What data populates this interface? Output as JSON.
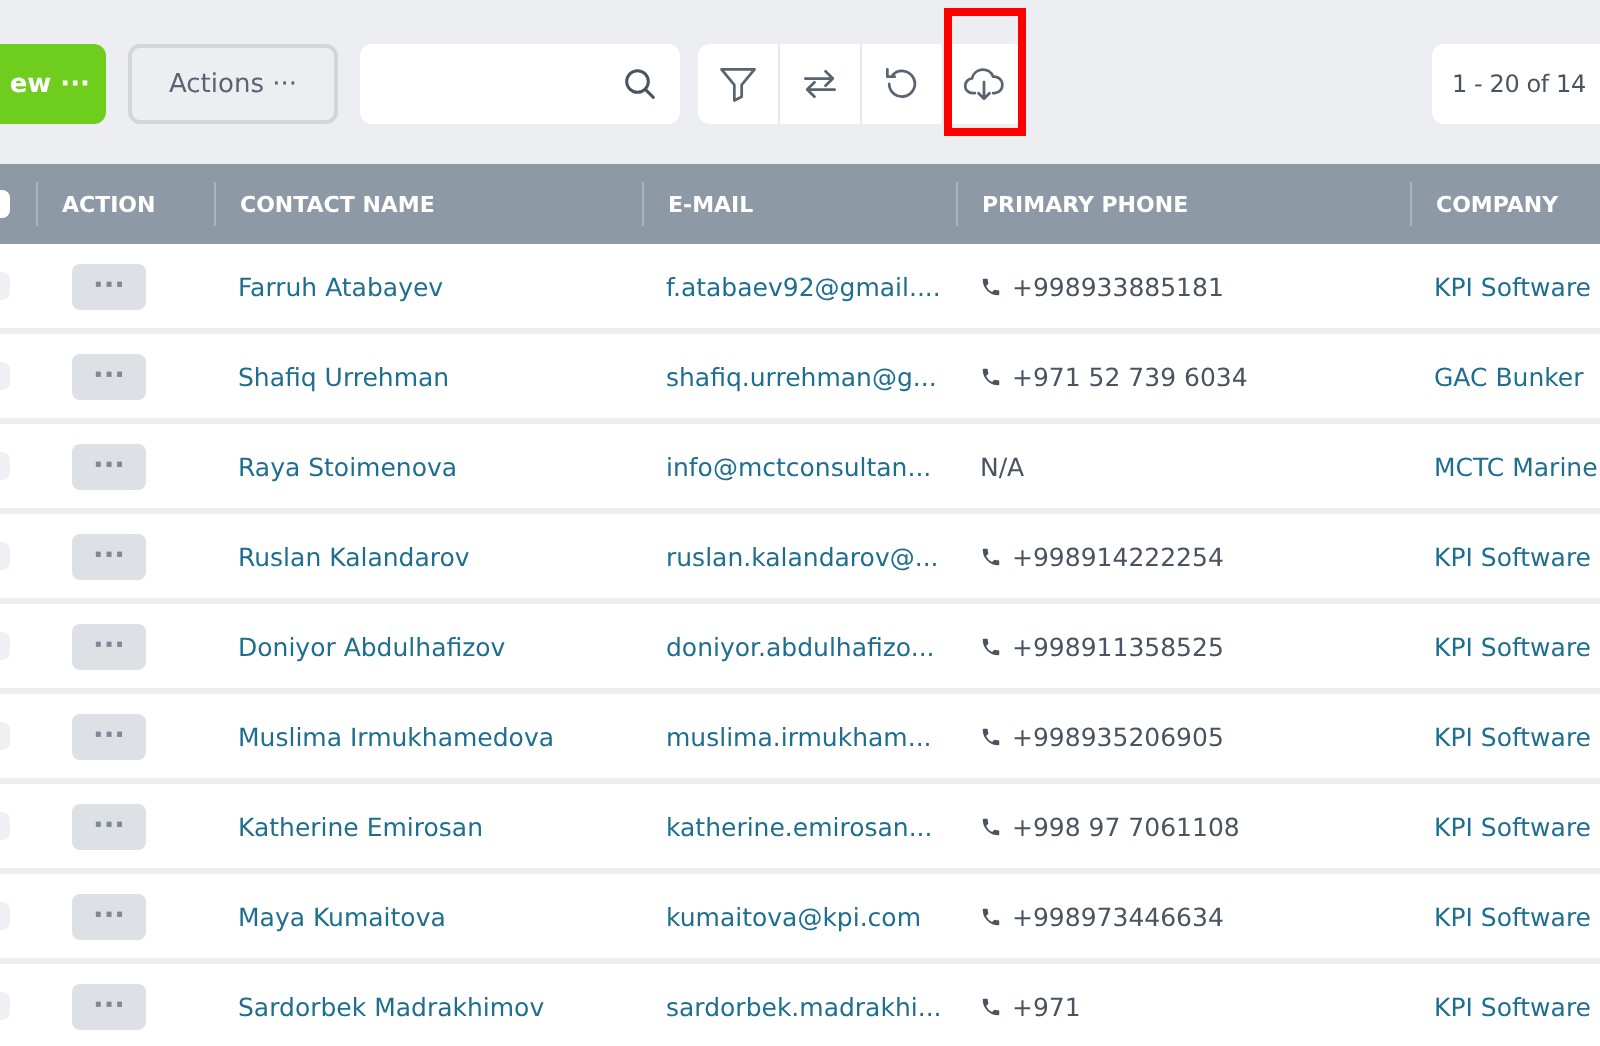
{
  "toolbar": {
    "new_button": "ew ···",
    "actions_button": "Actions ···",
    "tools": [
      {
        "kind": "filter"
      },
      {
        "kind": "swap"
      },
      {
        "kind": "reset"
      },
      {
        "kind": "download",
        "highlighted": true
      }
    ],
    "pagination": "1 - 20 of 14"
  },
  "table": {
    "select_all_checked": false,
    "columns": [
      "ACTION",
      "CONTACT NAME",
      "E-MAIL",
      "PRIMARY PHONE",
      "COMPANY"
    ],
    "rows": [
      {
        "checked": false,
        "action": "···",
        "name": "Farruh Atabayev",
        "email": "f.atabaev92@gmail....",
        "phone": "+998933885181",
        "company": "KPI Software"
      },
      {
        "checked": false,
        "action": "···",
        "name": "Shafiq Urrehman",
        "email": "shafiq.urrehman@g...",
        "phone": "+971 52 739 6034",
        "company": "GAC Bunker"
      },
      {
        "checked": false,
        "action": "···",
        "name": "Raya Stoimenova",
        "email": "info@mctconsultan...",
        "phone": "N/A",
        "company": "MCTC Marine"
      },
      {
        "checked": false,
        "action": "···",
        "name": "Ruslan Kalandarov",
        "email": "ruslan.kalandarov@...",
        "phone": "+998914222254",
        "company": "KPI Software"
      },
      {
        "checked": false,
        "action": "···",
        "name": "Doniyor Abdulhafizov",
        "email": "doniyor.abdulhafizo...",
        "phone": "+998911358525",
        "company": "KPI Software"
      },
      {
        "checked": false,
        "action": "···",
        "name": "Muslima Irmukhamedova",
        "email": "muslima.irmukham...",
        "phone": "+998935206905",
        "company": "KPI Software"
      },
      {
        "checked": false,
        "action": "···",
        "name": "Katherine Emirosan",
        "email": "katherine.emirosan...",
        "phone": "+998 97 7061108",
        "company": "KPI Software"
      },
      {
        "checked": false,
        "action": "···",
        "name": "Maya Kumaitova",
        "email": "kumaitova@kpi.com",
        "phone": "+998973446634",
        "company": "KPI Software"
      },
      {
        "checked": false,
        "action": "···",
        "name": "Sardorbek Madrakhimov",
        "email": "sardorbek.madrakhi...",
        "phone": "+971",
        "company": "KPI Software"
      }
    ]
  }
}
